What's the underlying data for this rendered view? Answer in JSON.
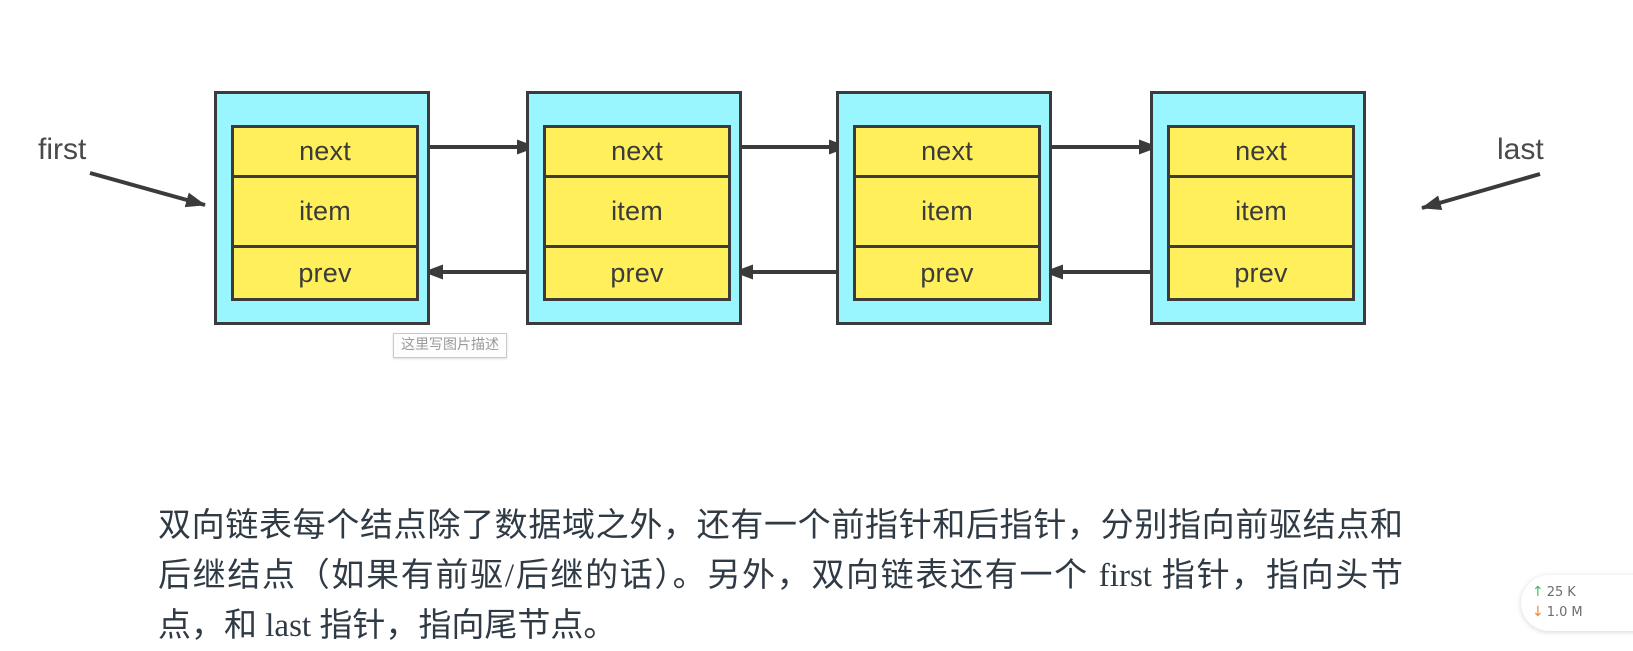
{
  "diagram": {
    "title": "Doubly linked list structure",
    "colors": {
      "node_fill": "#99f6ff",
      "field_fill": "#ffef5a",
      "stroke": "#3b3b3b",
      "text": "#3b3b3b",
      "page_background": "#ffffff"
    },
    "pointer_labels": {
      "first": "first",
      "last": "last"
    },
    "field_labels": {
      "next": "next",
      "item": "item",
      "prev": "prev"
    },
    "nodes": [
      {
        "index": 1,
        "fields": [
          "next",
          "item",
          "prev"
        ]
      },
      {
        "index": 2,
        "fields": [
          "next",
          "item",
          "prev"
        ]
      },
      {
        "index": 3,
        "fields": [
          "next",
          "item",
          "prev"
        ]
      },
      {
        "index": 4,
        "fields": [
          "next",
          "item",
          "prev"
        ]
      }
    ],
    "alt_tooltip": "这里写图片描述"
  },
  "article": {
    "paragraph": "双向链表每个结点除了数据域之外，还有一个前指针和后指针，分别指向前驱结点和后继结点（如果有前驱/后继的话）。另外，双向链表还有一个 first 指针，指向头节点，和 last 指针，指向尾节点。"
  },
  "network_widget": {
    "upload": {
      "icon": "arrow-up-icon",
      "arrow": "↑",
      "value": "25",
      "unit": "K",
      "color": "#3cc15b"
    },
    "download": {
      "icon": "arrow-down-icon",
      "arrow": "↓",
      "value": "1.0",
      "unit": "M",
      "color": "#f5862b"
    }
  }
}
